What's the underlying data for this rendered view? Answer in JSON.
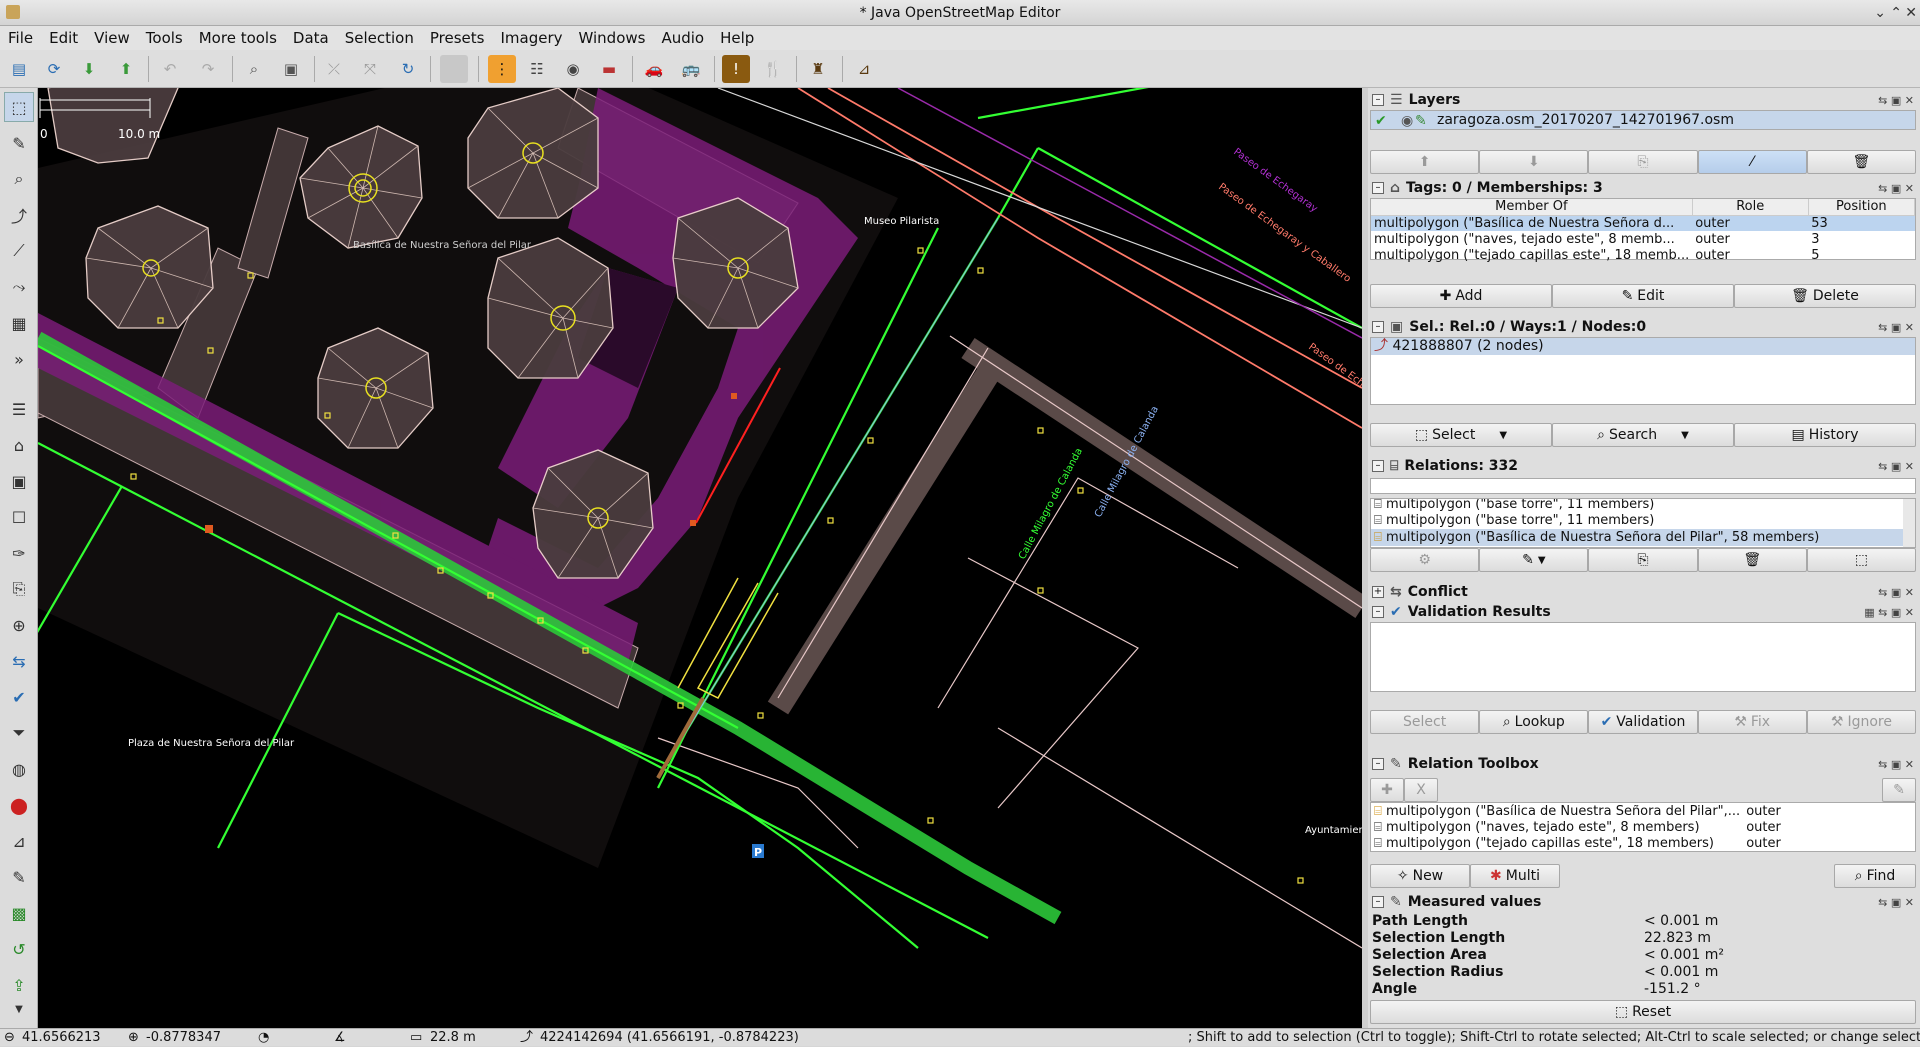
{
  "window": {
    "title": "* Java OpenStreetMap Editor"
  },
  "menu": [
    "File",
    "Edit",
    "View",
    "Tools",
    "More tools",
    "Data",
    "Selection",
    "Presets",
    "Imagery",
    "Windows",
    "Audio",
    "Help"
  ],
  "toolbar": {
    "icons": [
      "open-icon",
      "download-icon",
      "download-data-icon",
      "upload-icon",
      "undo-icon",
      "redo-icon",
      "zoom-icon",
      "preferences-icon",
      "split-way-icon",
      "combine-way-icon",
      "refresh-icon",
      "disabled-icon",
      "highway-preset-icon",
      "railway-preset-icon",
      "waterway-preset-icon",
      "barrier-preset-icon",
      "car-preset-icon",
      "bus-preset-icon",
      "warning-preset-icon",
      "restaurant-preset-icon",
      "castle-preset-icon",
      "industrial-preset-icon"
    ]
  },
  "map": {
    "scale_zero": "0",
    "scale_label": "10.0 m",
    "labels": {
      "basilica": "Basílica de Nuestra Señora del Pilar",
      "museo": "Museo Pilarista",
      "plaza": "Plaza de Nuestra Señora del Pilar",
      "calle_milagro_1": "Calle Milagro de Calanda",
      "calle_milagro_2": "Calle Milagro de Calanda",
      "paseo_1": "Paseo de Echegaray y Caballero",
      "paseo_2": "Paseo de Echegaray y Caballero",
      "paseo_3": "Paseo de Echegaray",
      "ayuntamiento": "Ayuntamien"
    }
  },
  "layers": {
    "title": "Layers",
    "file": "zaragoza.osm_20170207_142701967.osm"
  },
  "tags": {
    "title": "Tags: 0 / Memberships: 3",
    "headers": [
      "Member Of",
      "Role",
      "Position"
    ],
    "rows": [
      {
        "member": "multipolygon (\"Basílica de Nuestra Señora d...",
        "role": "outer",
        "pos": "53"
      },
      {
        "member": "multipolygon (\"naves, tejado este\", 8 memb...",
        "role": "outer",
        "pos": "3"
      },
      {
        "member": "multipolygon (\"tejado capillas este\", 18 memb...",
        "role": "outer",
        "pos": "5"
      }
    ],
    "add": "Add",
    "edit": "Edit",
    "delete": "Delete"
  },
  "selection": {
    "title": "Sel.: Rel.:0 / Ways:1 / Nodes:0",
    "item": "421888807 (2 nodes)",
    "select": "Select",
    "search": "Search",
    "history": "History"
  },
  "relations": {
    "title": "Relations: 332",
    "items": [
      "multipolygon (\"base torre\", 11 members)",
      "multipolygon (\"base torre\", 11 members)",
      "multipolygon (\"Basílica de Nuestra Señora del Pilar\", 58 members)"
    ]
  },
  "conflict": {
    "title": "Conflict"
  },
  "validation": {
    "title": "Validation Results",
    "select": "Select",
    "lookup": "Lookup",
    "validation": "Validation",
    "fix": "Fix",
    "ignore": "Ignore"
  },
  "toolbox": {
    "title": "Relation Toolbox",
    "x": "X",
    "rows": [
      {
        "name": "multipolygon (\"Basílica de Nuestra Señora del Pilar\",...",
        "role": "outer"
      },
      {
        "name": "multipolygon (\"naves, tejado este\", 8 members)",
        "role": "outer"
      },
      {
        "name": "multipolygon (\"tejado capillas este\", 18 members)",
        "role": "outer"
      }
    ],
    "new": "New",
    "multi": "Multi",
    "find": "Find"
  },
  "measured": {
    "title": "Measured values",
    "rows": [
      {
        "k": "Path Length",
        "v": "< 0.001 m"
      },
      {
        "k": "Selection Length",
        "v": "22.823 m"
      },
      {
        "k": "Selection Area",
        "v": "< 0.001 m²"
      },
      {
        "k": "Selection Radius",
        "v": "< 0.001 m"
      },
      {
        "k": "Angle",
        "v": "-151.2 °"
      }
    ],
    "reset": "Reset"
  },
  "status": {
    "lat": "41.6566213",
    "lon": "-0.8778347",
    "dist": "22.8 m",
    "node": "4224142694 (41.6566191, -0.8784223)",
    "hint": "; Shift to add to selection (Ctrl to toggle); Shift-Ctrl to rotate selected; Alt-Ctrl to scale selected; or change selection"
  }
}
